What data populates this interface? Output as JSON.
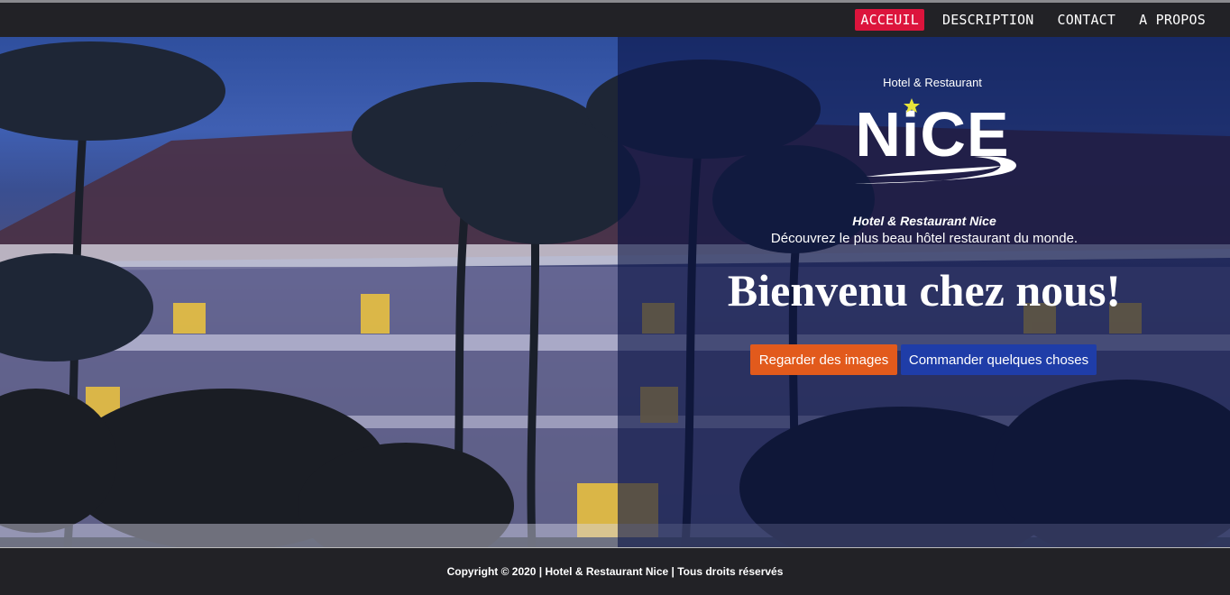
{
  "nav": {
    "items": [
      {
        "label": "ACCEUIL",
        "active": true
      },
      {
        "label": "DESCRIPTION",
        "active": false
      },
      {
        "label": "CONTACT",
        "active": false
      },
      {
        "label": "A PROPOS",
        "active": false
      }
    ]
  },
  "hero": {
    "logo": {
      "top_text": "Hotel & Restaurant",
      "brand_text": "NiCE"
    },
    "tagline_title": "Hotel & Restaurant Nice",
    "tagline_sub": "Découvrez le plus beau hôtel restaurant du monde.",
    "headline": "Bienvenu chez nous!",
    "buttons": {
      "primary": "Regarder des images",
      "secondary": "Commander quelques choses"
    }
  },
  "footer": {
    "text": "Copyright © 2020 | Hotel & Restaurant Nice | Tous droits réservés"
  },
  "colors": {
    "nav_active": "#dc143c",
    "btn_orange": "#e25a1c",
    "btn_blue": "#1f3da8",
    "dark_bg": "#222226"
  }
}
